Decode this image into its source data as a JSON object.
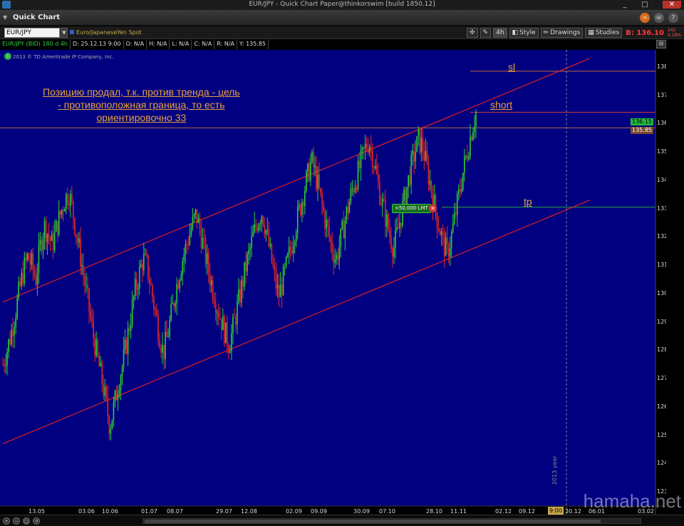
{
  "window": {
    "title": "EUR/JPY - Quick Chart Paper@thinkorswim [build 1850.12]",
    "minimize": "_",
    "maximize": "□",
    "close": "✕"
  },
  "header": {
    "app_title": "Quick Chart",
    "icons": [
      "link-icon",
      "phone-icon",
      "help-icon"
    ]
  },
  "toolbar": {
    "symbol": "EUR/JPY",
    "symbol_description": "Euro/JapaneseYen Spot",
    "aggregation": "4h",
    "style_label": "Style",
    "drawings_label": "Drawings",
    "studies_label": "Studies",
    "bid_label": "B: 136.10",
    "bid_suffix": "B",
    "bid_change_top": "242",
    "bid_change_bottom": "0.18%"
  },
  "infobar": {
    "symbol": "EUR/JPY (BID) 180 d 4h",
    "date": "D: 25.12.13 9:00",
    "open": "O: N/A",
    "high": "H: N/A",
    "low": "L: N/A",
    "close": "C: N/A",
    "range": "R: N/A",
    "y": "Y: 135.85"
  },
  "watermark": "2013 © TD Ameritrade IP Company, Inc.",
  "annotations": {
    "main_line1": "Позицию продал, т.к. против тренда - цель",
    "main_line2": "- противоположная граница, то есть",
    "main_line3": "ориентировочно 33",
    "sl": "sl",
    "short": "short",
    "tp": "tp"
  },
  "order": {
    "label": "+50,000 LMT",
    "cancel": "✕"
  },
  "price_labels": {
    "ask": "136.15",
    "last": "135.85"
  },
  "cursor": {
    "time": "9:00",
    "year": "2013 year"
  },
  "site_watermark": "hamaha.net",
  "colors": {
    "chart_bg": "#000080",
    "up_candle": "#2fd02a",
    "down_candle": "#e8281e",
    "channel_line": "#e02020",
    "annotation": "#e8a23a"
  },
  "chart_data": {
    "type": "candlestick",
    "title": "EUR/JPY (BID) 180 d 4h",
    "xlabel": "",
    "ylabel": "",
    "ylim": [
      122.5,
      138.6
    ],
    "y_ticks": [
      123,
      124,
      125,
      126,
      127,
      128,
      129,
      130,
      131,
      132,
      133,
      134,
      135,
      136,
      137,
      138
    ],
    "x_ticks": [
      "13.05",
      "03.06",
      "10.06",
      "01.07",
      "08.07",
      "29.07",
      "12.08",
      "02.09",
      "09.09",
      "30.09",
      "07.10",
      "28.10",
      "11.11",
      "02.12",
      "09.12",
      "30.12",
      "06.01",
      "03.02"
    ],
    "grid": false,
    "channel_upper": {
      "from_price": 129.7,
      "to_price": 138.3
    },
    "channel_lower": {
      "from_price": 124.7,
      "to_price": 133.3
    },
    "horizontal_levels": [
      {
        "name": "sl",
        "price": 137.85
      },
      {
        "name": "short",
        "price": 136.4
      },
      {
        "name": "last",
        "price": 135.85
      },
      {
        "name": "tp",
        "price": 133.05
      }
    ],
    "close_path": [
      127.5,
      128.0,
      128.6,
      129.3,
      130.1,
      130.8,
      131.3,
      131.0,
      130.5,
      131.6,
      132.4,
      132.1,
      131.7,
      132.3,
      132.8,
      133.3,
      133.6,
      132.9,
      132.0,
      131.2,
      130.3,
      129.4,
      128.5,
      127.7,
      127.0,
      126.2,
      125.3,
      126.0,
      126.8,
      127.4,
      128.2,
      129.1,
      130.0,
      130.6,
      131.2,
      131.0,
      130.2,
      129.4,
      128.6,
      127.9,
      128.5,
      129.3,
      130.1,
      130.8,
      131.4,
      131.9,
      132.4,
      132.8,
      132.2,
      131.5,
      130.8,
      130.2,
      129.6,
      129.1,
      128.6,
      128.2,
      128.8,
      129.5,
      130.2,
      130.9,
      131.5,
      132.1,
      132.6,
      132.9,
      132.2,
      131.4,
      130.6,
      129.9,
      130.4,
      131.0,
      131.6,
      132.3,
      132.9,
      133.5,
      134.1,
      134.7,
      134.2,
      133.5,
      132.8,
      132.2,
      131.6,
      131.2,
      131.8,
      132.5,
      133.1,
      133.7,
      134.1,
      134.6,
      135.1,
      135.4,
      134.8,
      134.0,
      133.3,
      132.7,
      132.1,
      131.6,
      132.2,
      132.9,
      133.6,
      134.3,
      134.9,
      135.4,
      135.2,
      134.5,
      133.8,
      133.0,
      132.4,
      131.8,
      131.4,
      132.0,
      132.8,
      133.6,
      134.4,
      135.1,
      135.8,
      136.4
    ]
  }
}
